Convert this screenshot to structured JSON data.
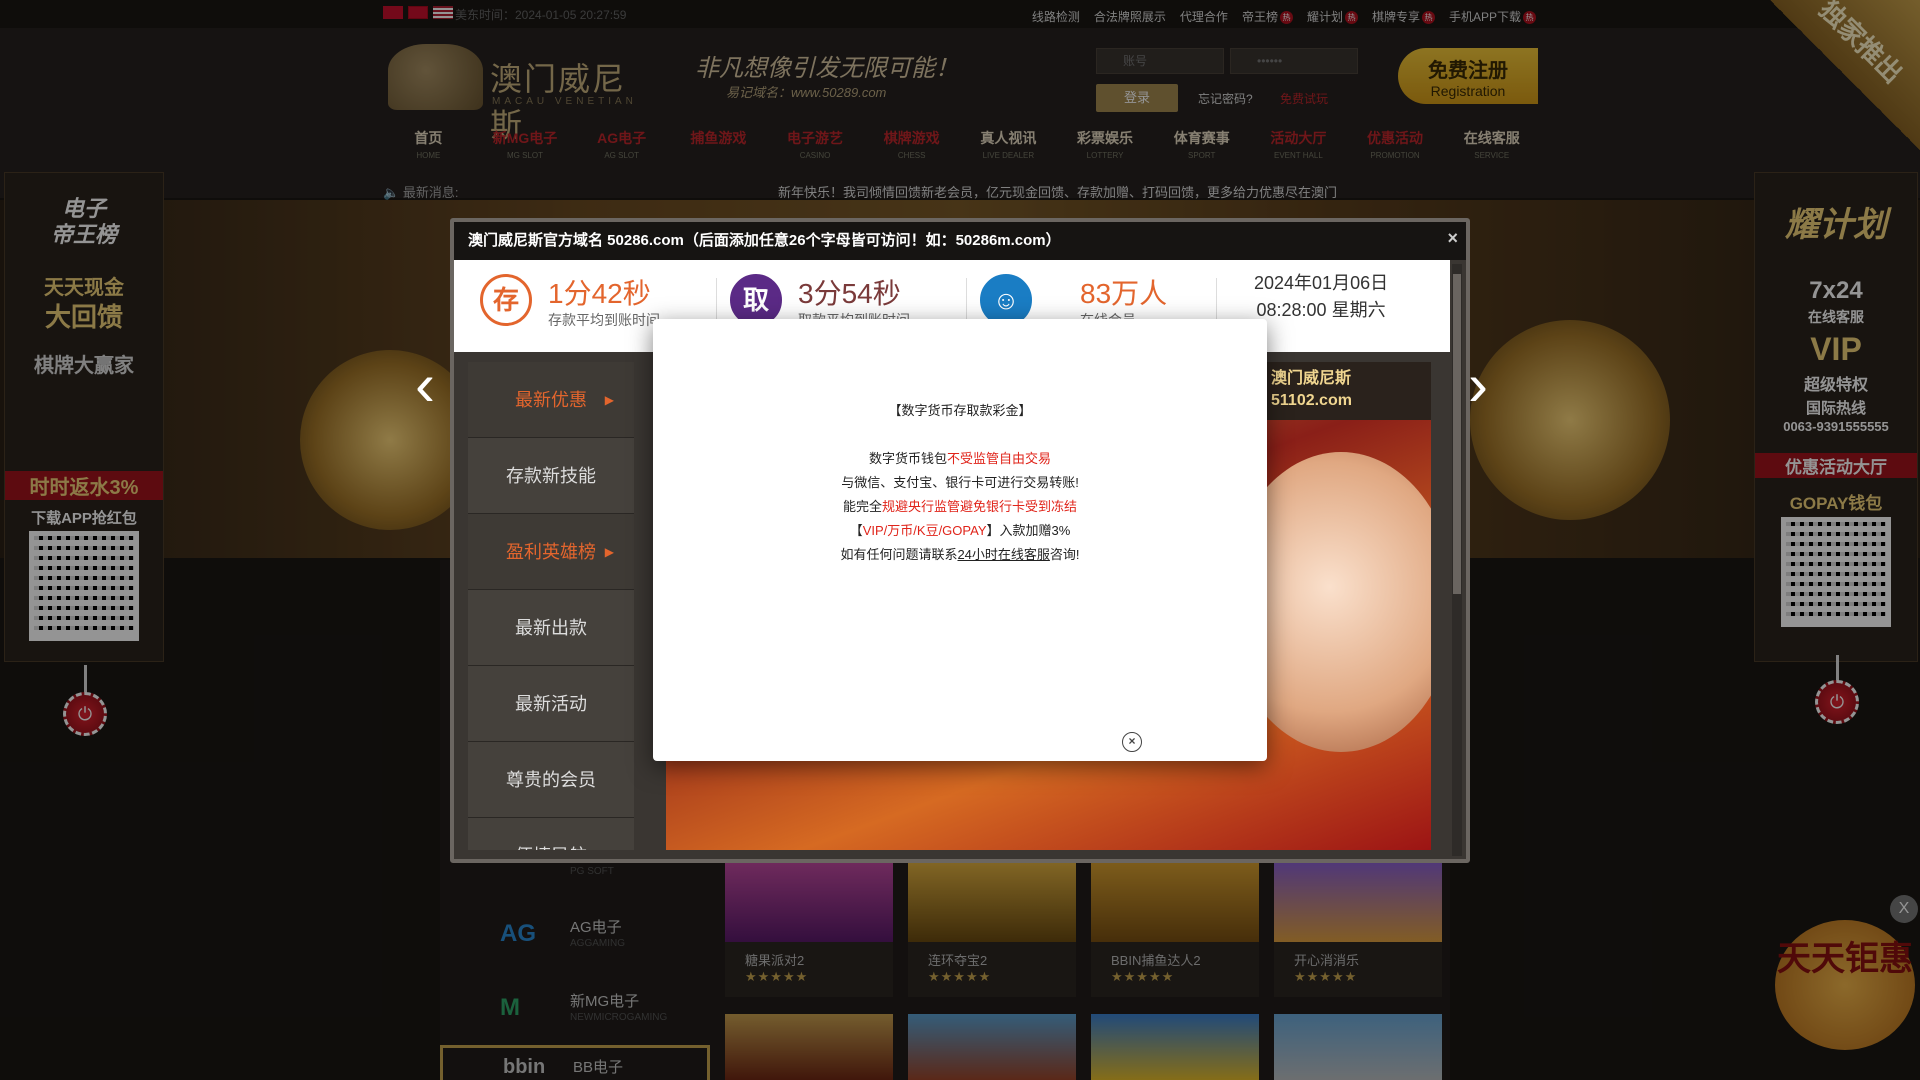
{
  "topbar": {
    "time": "美东时间：2024-01-05  20:27:59",
    "links": [
      "线路检测",
      "合法牌照展示",
      "代理合作",
      "帝王榜",
      "耀计划",
      "棋牌专享",
      "手机APP下载"
    ],
    "hot_label": "热"
  },
  "header": {
    "logo_name": "澳门威尼斯",
    "logo_sub": "MACAU VENETIAN",
    "slogan": "非凡想像引发无限可能！",
    "slogan_sub": "易记域名：www.50289.com",
    "username_placeholder": "账号",
    "password_placeholder": "••••••",
    "login_label": "登录",
    "forgot_label": "忘记密码?",
    "trial_label": "免费试玩",
    "register_zh": "免费注册",
    "register_en": "Registration",
    "corner_label": "独家推出"
  },
  "nav": [
    {
      "zh": "首页",
      "en": "HOME",
      "red": false
    },
    {
      "zh": "新MG电子",
      "en": "MG SLOT",
      "red": true
    },
    {
      "zh": "AG电子",
      "en": "AG SLOT",
      "red": true
    },
    {
      "zh": "捕鱼游戏",
      "en": "",
      "red": true
    },
    {
      "zh": "电子游艺",
      "en": "CASINO",
      "red": true
    },
    {
      "zh": "棋牌游戏",
      "en": "CHESS",
      "red": true
    },
    {
      "zh": "真人视讯",
      "en": "LIVE DEALER",
      "red": false
    },
    {
      "zh": "彩票娱乐",
      "en": "LOTTERY",
      "red": false
    },
    {
      "zh": "体育赛事",
      "en": "SPORT",
      "red": false
    },
    {
      "zh": "活动大厅",
      "en": "EVENT HALL",
      "red": true
    },
    {
      "zh": "优惠活动",
      "en": "PROMOTION",
      "red": true
    },
    {
      "zh": "在线客服",
      "en": "SERVICE",
      "red": false
    }
  ],
  "marquee": {
    "label": "最新消息:",
    "text": "新年快乐！我司倾情回馈新老会员，亿元现金回馈、存款加赠、打码回馈，更多给力优惠尽在澳门"
  },
  "left_float": {
    "t1": "电子",
    "t2": "帝王榜",
    "t3": "天天现金",
    "t4": "大回馈",
    "t5": "棋牌大赢家",
    "t6": "时时返水3%",
    "t7": "下载APP抢红包"
  },
  "right_float": {
    "t1": "耀计划",
    "t2": "7x24",
    "t3": "在线客服",
    "t4": "VIP",
    "t5": "超级特权",
    "t6": "国际热线",
    "t7": "0063-9391555555",
    "t8": "优惠活动大厅",
    "t9": "GOPAY钱包"
  },
  "providers": [
    {
      "name": "",
      "en": "PG SOFT"
    },
    {
      "name": "AG电子",
      "en": "AGGAMING",
      "logo": "AG"
    },
    {
      "name": "新MG电子",
      "en": "NEWMICROGAMING",
      "logo": "M"
    },
    {
      "name": "BB电子",
      "en": "",
      "logo": "bbin"
    }
  ],
  "games": [
    {
      "name": "糖果派对2",
      "stars": "★★★★★"
    },
    {
      "name": "连环夺宝2",
      "stars": "★★★★★"
    },
    {
      "name": "BBIN捕鱼达人2",
      "stars": "★★★★★"
    },
    {
      "name": "开心消消乐",
      "stars": "★★★★★"
    }
  ],
  "promo_corner": {
    "text": "天天钜惠",
    "close": "X"
  },
  "notice": {
    "title": "澳门威尼斯官方域名 50286.com（后面添加任意26个字母皆可访问！如：50286m.com）",
    "close": "×",
    "stats": [
      {
        "icon": "存",
        "value": "1分42秒",
        "label": "存款平均到账时间"
      },
      {
        "icon": "取",
        "value": "3分54秒",
        "label": "取款平均到账时间"
      },
      {
        "icon": "☺",
        "value": "83万人",
        "label": "在线会员"
      }
    ],
    "date": "2024年01月06日",
    "time": "08:28:00 星期六",
    "menu": [
      {
        "label": "最新优惠",
        "hl": true
      },
      {
        "label": "存款新技能",
        "hl": false
      },
      {
        "label": "盈利英雄榜",
        "hl": true
      },
      {
        "label": "最新出款",
        "hl": false
      },
      {
        "label": "最新活动",
        "hl": false
      },
      {
        "label": "尊贵的会员",
        "hl": false
      },
      {
        "label": "便捷导航",
        "hl": false
      }
    ],
    "promo_brand_1": "澳门威尼斯",
    "promo_brand_2": "51102.com",
    "prev": "‹",
    "next": "›"
  },
  "popup": {
    "heading": "【数字货币存取款彩金】",
    "l1a": "数字货币钱包",
    "l1b": "不受监管自由交易",
    "l2": "与微信、支付宝、银行卡可进行交易转账!",
    "l3a": "能完全",
    "l3b": "规避央行监管避免银行卡受到冻结",
    "l4a": "【",
    "l4b": "VIP/万币/K豆/GOPAY",
    "l4c": "】入款加赠3%",
    "l5a": "如有任何问题请联系",
    "l5b": "24小时在线客服",
    "l5c": "咨询!",
    "close": "×"
  }
}
